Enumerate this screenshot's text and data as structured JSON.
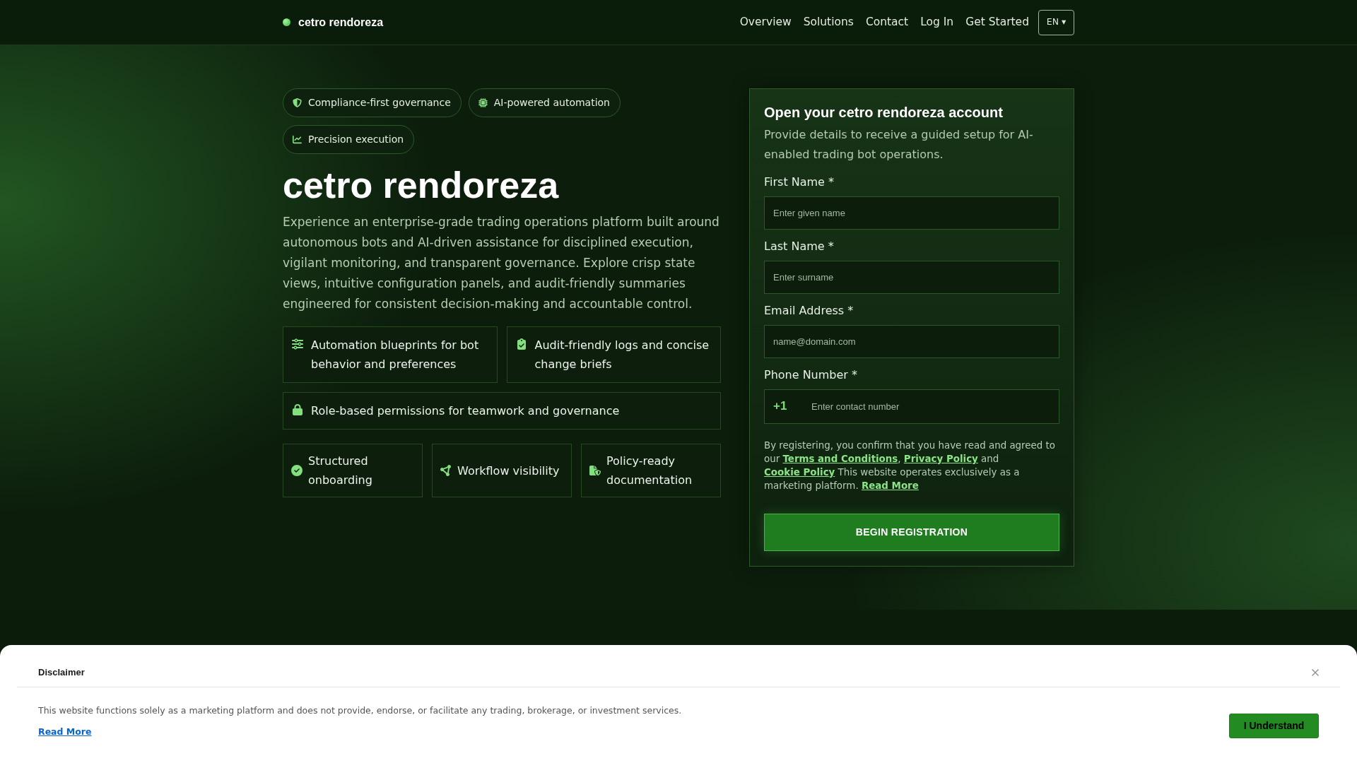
{
  "header": {
    "brand": "cetro rendoreza",
    "nav": [
      "Overview",
      "Solutions",
      "Contact",
      "Log In",
      "Get Started"
    ],
    "language": "EN ▾"
  },
  "hero": {
    "badges": [
      "Compliance-first governance",
      "AI-powered automation",
      "Precision execution"
    ],
    "title": "cetro rendoreza",
    "description": "Experience an enterprise-grade trading operations platform built around autonomous bots and AI-driven assistance for disciplined execution, vigilant monitoring, and transparent governance. Explore crisp state views, intuitive configuration panels, and audit-friendly summaries engineered for consistent decision-making and accountable control.",
    "features": [
      "Automation blueprints for bot behavior and preferences",
      "Audit-friendly logs and concise change briefs",
      "Role-based permissions for teamwork and governance"
    ],
    "highlights": [
      "Structured onboarding",
      "Workflow visibility",
      "Policy-ready documentation"
    ]
  },
  "form": {
    "title": "Open your cetro rendoreza account",
    "subtitle": "Provide details to receive a guided setup for AI-enabled trading bot operations.",
    "fields": [
      {
        "kind": "text",
        "label": "First Name *",
        "placeholder": "Enter given name"
      },
      {
        "kind": "text",
        "label": "Last Name *",
        "placeholder": "Enter surname"
      },
      {
        "kind": "email",
        "label": "Email Address *",
        "placeholder": "name@domain.com"
      },
      {
        "kind": "phone",
        "label": "Phone Number *",
        "prefix": "+1",
        "placeholder": "Enter contact number"
      }
    ],
    "consent": [
      {
        "kind": "text",
        "text": "By registering, you confirm that you have read and agreed to our "
      },
      {
        "kind": "link",
        "text": "Terms and Conditions"
      },
      {
        "kind": "text",
        "text": ", "
      },
      {
        "kind": "link",
        "text": "Privacy Policy"
      },
      {
        "kind": "text",
        "text": " and "
      },
      {
        "kind": "link",
        "text": "Cookie Policy"
      },
      {
        "kind": "text",
        "text": " This website operates exclusively as a marketing platform. "
      },
      {
        "kind": "link",
        "text": "Read More"
      }
    ],
    "submit": "BEGIN REGISTRATION"
  },
  "disclaimer": {
    "title": "Disclaimer",
    "text": "This website functions solely as a marketing platform and does not provide, endorse, or facilitate any trading, brokerage, or investment services.",
    "link": "Read More",
    "button": "I Understand"
  }
}
